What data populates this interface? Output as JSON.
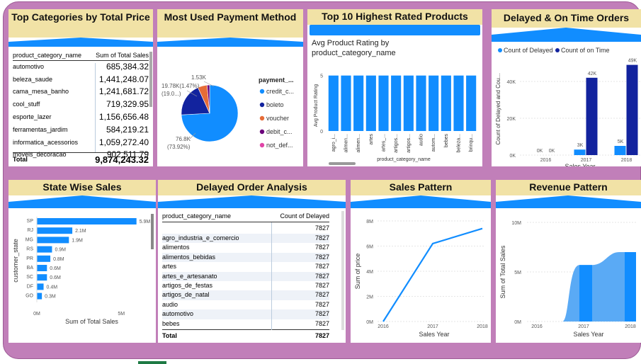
{
  "top_categories": {
    "title": "Top Categories by Total Price",
    "col_category": "product_category_name",
    "col_sum": "Sum of Total Sales",
    "rows": [
      {
        "category": "automotivo",
        "value": "685,384.32"
      },
      {
        "category": "beleza_saude",
        "value": "1,441,248.07"
      },
      {
        "category": "cama_mesa_banho",
        "value": "1,241,681.72"
      },
      {
        "category": "cool_stuff",
        "value": "719,329.95"
      },
      {
        "category": "esporte_lazer",
        "value": "1,156,656.48"
      },
      {
        "category": "ferramentas_jardim",
        "value": "584,219.21"
      },
      {
        "category": "informatica_acessorios",
        "value": "1,059,272.40"
      },
      {
        "category": "moveis_decoracao",
        "value": "902,511.79"
      }
    ],
    "total_label": "Total",
    "total_value": "9,874,243.32"
  },
  "payment": {
    "title": "Most Used Payment Method",
    "legend_title": "payment_...",
    "legend": [
      {
        "label": "credit_c...",
        "color": "#118dff"
      },
      {
        "label": "boleto",
        "color": "#12239e"
      },
      {
        "label": "voucher",
        "color": "#e66c37"
      },
      {
        "label": "debit_c...",
        "color": "#6b007b"
      },
      {
        "label": "not_def...",
        "color": "#e044a7"
      }
    ],
    "label_top": "1.53K",
    "label_left_1": "19.78K(1.47%)",
    "label_left_2": "(19.0...)",
    "label_bottom_1": "76.8K",
    "label_bottom_2": "(73.92%)"
  },
  "rated": {
    "title": "Top 10 Highest Rated Products",
    "chart_title": "Avg Product Rating by product_category_name",
    "ylabel": "Avg Product Rating",
    "xlabel": "product_category_name",
    "y_tick_5": "5",
    "y_tick_0": "0"
  },
  "delayed_ontime": {
    "title": "Delayed & On Time Orders",
    "legend_delayed": "Count of Delayed",
    "legend_ontime": "Count of on Time",
    "ylabel": "Count of Delayed and Cou...",
    "xlabel": "Sales Year",
    "y_ticks": [
      "40K",
      "20K",
      "0K"
    ],
    "x_ticks": [
      "2016",
      "2017",
      "2018"
    ],
    "labels": [
      "0K",
      "0K",
      "3K",
      "42K",
      "5K",
      "49K"
    ],
    "colors": {
      "delayed": "#118dff",
      "ontime": "#12239e"
    }
  },
  "state_sales": {
    "title": "State Wise Sales",
    "ylabel": "customer_state",
    "xlabel": "Sum of Total Sales",
    "x_ticks": [
      "0M",
      "5M"
    ],
    "bars": [
      {
        "state": "SP",
        "label": "5.9M"
      },
      {
        "state": "RJ",
        "label": "2.1M"
      },
      {
        "state": "MG",
        "label": "1.9M"
      },
      {
        "state": "RS",
        "label": "0.9M"
      },
      {
        "state": "PR",
        "label": "0.8M"
      },
      {
        "state": "BA",
        "label": "0.6M"
      },
      {
        "state": "SC",
        "label": "0.6M"
      },
      {
        "state": "DF",
        "label": "0.4M"
      },
      {
        "state": "GO",
        "label": "0.3M"
      }
    ]
  },
  "delayed_analysis": {
    "title": "Delayed Order Analysis",
    "col_category": "product_category_name",
    "col_count": "Count of Delayed",
    "first_value": "7827",
    "rows": [
      {
        "category": "agro_industria_e_comercio",
        "value": "7827"
      },
      {
        "category": "alimentos",
        "value": "7827"
      },
      {
        "category": "alimentos_bebidas",
        "value": "7827"
      },
      {
        "category": "artes",
        "value": "7827"
      },
      {
        "category": "artes_e_artesanato",
        "value": "7827"
      },
      {
        "category": "artigos_de_festas",
        "value": "7827"
      },
      {
        "category": "artigos_de_natal",
        "value": "7827"
      },
      {
        "category": "audio",
        "value": "7827"
      },
      {
        "category": "automotivo",
        "value": "7827"
      },
      {
        "category": "bebes",
        "value": "7827"
      }
    ],
    "total_label": "Total",
    "total_value": "7827"
  },
  "sales_pattern": {
    "title": "Sales Pattern",
    "ylabel": "Sum of price",
    "xlabel": "Sales Year",
    "y_ticks": [
      "8M",
      "6M",
      "4M",
      "2M",
      "0M"
    ],
    "x_ticks": [
      "2016",
      "2017",
      "2018"
    ]
  },
  "revenue_pattern": {
    "title": "Revenue Pattern",
    "ylabel": "Sum of Total Sales",
    "xlabel": "Sales Year",
    "y_ticks": [
      "10M",
      "5M",
      "0M"
    ],
    "x_ticks": [
      "2016",
      "2017",
      "2018"
    ]
  },
  "chart_data": [
    {
      "type": "pie",
      "title": "Most Used Payment Method",
      "categories": [
        "credit_card",
        "boleto",
        "voucher",
        "debit_card",
        "not_defined"
      ],
      "values": [
        76.8,
        19.78,
        5.5,
        1.53,
        0.0
      ]
    },
    {
      "type": "bar",
      "title": "Avg Product Rating by product_category_name",
      "ylabel": "Avg Product Rating",
      "xlabel": "product_category_name",
      "categories": [
        "agro_i...",
        "alimen...",
        "alimen...",
        "artes",
        "artes_...",
        "artigos...",
        "artigos...",
        "audio",
        "autom...",
        "bebes",
        "beleza...",
        "brinqu..."
      ],
      "values": [
        5,
        5,
        5,
        5,
        5,
        5,
        5,
        5,
        5,
        5,
        5,
        5
      ],
      "ylim": [
        0,
        6
      ]
    },
    {
      "type": "bar",
      "title": "Delayed & On Time Orders",
      "xlabel": "Sales Year",
      "ylabel": "Count of Delayed and Cou...",
      "categories": [
        "2016",
        "2017",
        "2018"
      ],
      "series": [
        {
          "name": "Count of Delayed",
          "values": [
            0,
            3,
            5
          ]
        },
        {
          "name": "Count of on Time",
          "values": [
            0,
            42,
            49
          ]
        }
      ],
      "ylim": [
        0,
        50
      ]
    },
    {
      "type": "bar",
      "title": "State Wise Sales",
      "xlabel": "Sum of Total Sales",
      "ylabel": "customer_state",
      "categories": [
        "SP",
        "RJ",
        "MG",
        "RS",
        "PR",
        "BA",
        "SC",
        "DF",
        "GO"
      ],
      "values": [
        5.9,
        2.1,
        1.9,
        0.9,
        0.8,
        0.6,
        0.6,
        0.4,
        0.3
      ],
      "xlim": [
        0,
        6.5
      ]
    },
    {
      "type": "line",
      "title": "Sales Pattern",
      "xlabel": "Sales Year",
      "ylabel": "Sum of price",
      "x": [
        2016,
        2017,
        2018
      ],
      "values": [
        0,
        6.2,
        7.4
      ],
      "ylim": [
        0,
        8
      ]
    },
    {
      "type": "area",
      "title": "Revenue Pattern",
      "xlabel": "Sales Year",
      "ylabel": "Sum of Total Sales",
      "x": [
        2016,
        2017,
        2018
      ],
      "values": [
        0,
        5.7,
        7.0
      ],
      "ylim": [
        0,
        10
      ]
    }
  ]
}
